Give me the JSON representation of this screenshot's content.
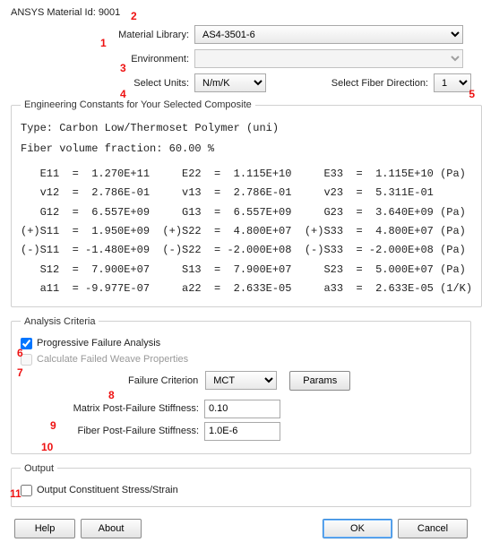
{
  "header": {
    "material_id_label": "ANSYS Material Id: 9001",
    "material_library_label": "Material Library:",
    "material_library_value": "AS4-3501-6",
    "environment_label": "Environment:",
    "environment_value": "",
    "select_units_label": "Select Units:",
    "select_units_value": "N/m/K",
    "select_fiber_label": "Select Fiber Direction:",
    "select_fiber_value": "1"
  },
  "constants": {
    "legend": "Engineering Constants for Your Selected Composite",
    "type_line": "Type: Carbon Low/Thermoset Polymer (uni)",
    "fvf_line": "Fiber volume fraction: 60.00 %",
    "row_E": "   E11  =  1.270E+11     E22  =  1.115E+10     E33  =  1.115E+10 (Pa)",
    "row_v": "   v12  =  2.786E-01     v13  =  2.786E-01     v23  =  5.311E-01",
    "row_G": "   G12  =  6.557E+09     G13  =  6.557E+09     G23  =  3.640E+09 (Pa)",
    "row_Sp": "(+)S11  =  1.950E+09  (+)S22  =  4.800E+07  (+)S33  =  4.800E+07 (Pa)",
    "row_Sm": "(-)S11  = -1.480E+09  (-)S22  = -2.000E+08  (-)S33  = -2.000E+08 (Pa)",
    "row_S12": "   S12  =  7.900E+07     S13  =  7.900E+07     S23  =  5.000E+07 (Pa)",
    "row_a": "   a11  = -9.977E-07     a22  =  2.633E-05     a33  =  2.633E-05 (1/K)"
  },
  "analysis": {
    "legend": "Analysis Criteria",
    "progressive_label": "Progressive Failure Analysis",
    "progressive_checked": true,
    "weave_label": "Calculate Failed Weave Properties",
    "weave_checked": false,
    "failure_criterion_label": "Failure Criterion",
    "failure_criterion_value": "MCT",
    "params_button": "Params",
    "matrix_pfs_label": "Matrix Post-Failure Stiffness:",
    "matrix_pfs_value": "0.10",
    "fiber_pfs_label": "Fiber Post-Failure Stiffness:",
    "fiber_pfs_value": "1.0E-6"
  },
  "output": {
    "legend": "Output",
    "constituent_label": "Output Constituent Stress/Strain",
    "constituent_checked": false
  },
  "footer": {
    "help": "Help",
    "about": "About",
    "ok": "OK",
    "cancel": "Cancel"
  },
  "annotations": {
    "n1": "1",
    "n2": "2",
    "n3": "3",
    "n4": "4",
    "n5": "5",
    "n6": "6",
    "n7": "7",
    "n8": "8",
    "n9": "9",
    "n10": "10",
    "n11": "11"
  }
}
